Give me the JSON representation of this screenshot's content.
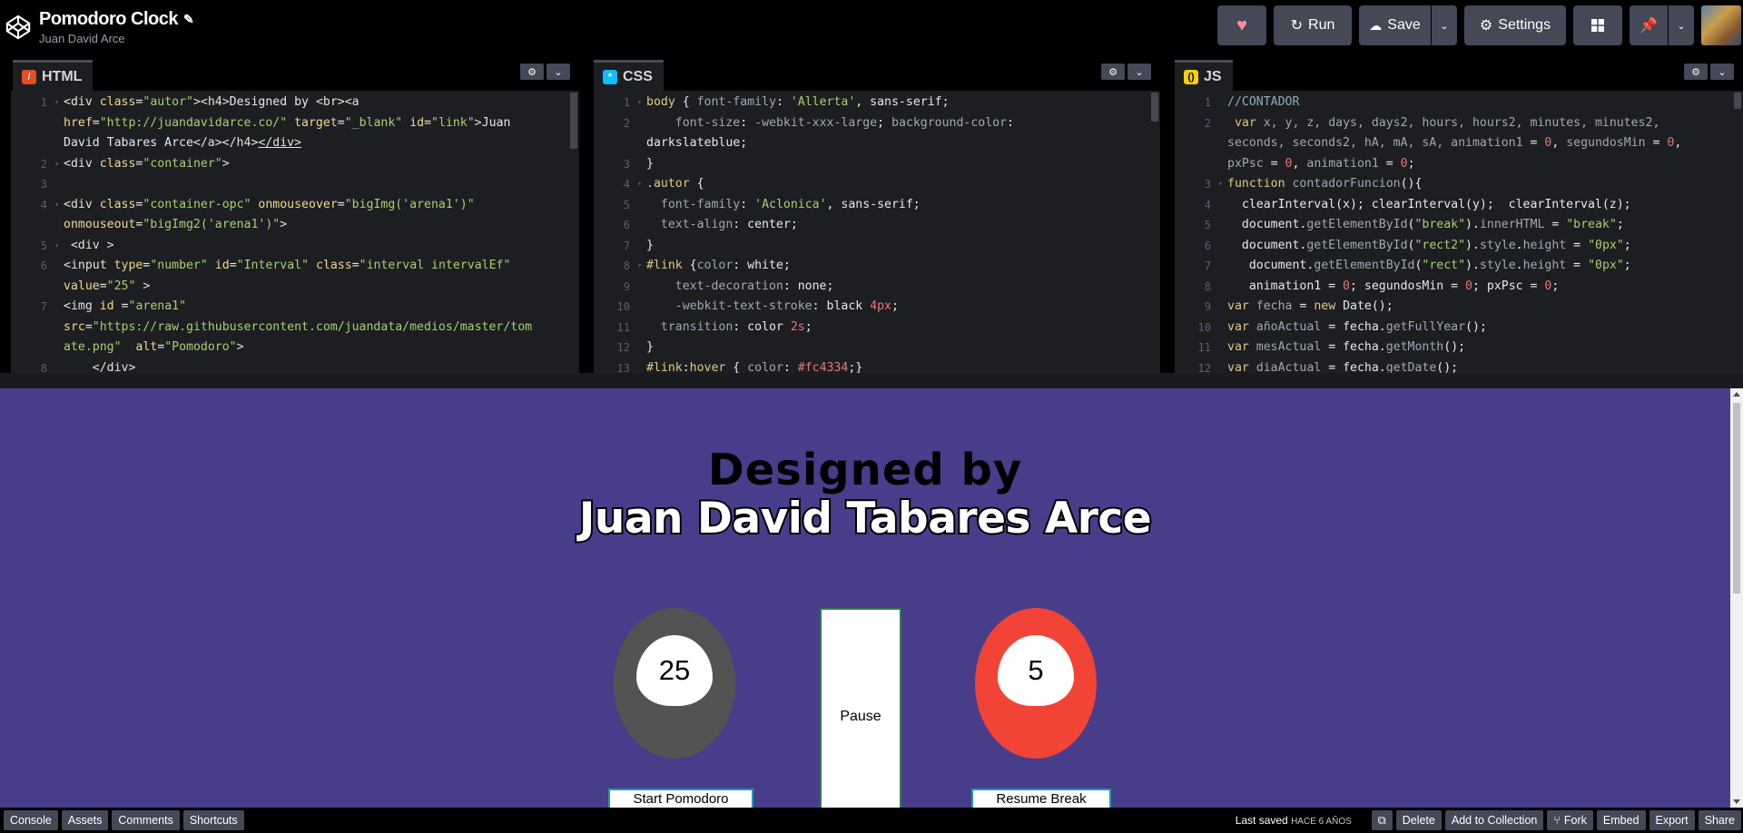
{
  "header": {
    "pen_title": "Pomodoro Clock",
    "author": "Juan David Arce",
    "buttons": {
      "run": "Run",
      "save": "Save",
      "settings": "Settings"
    }
  },
  "editors": {
    "html": {
      "label": "HTML",
      "icon_color": "#e44d26",
      "icon_glyph": "/"
    },
    "css": {
      "label": "CSS",
      "icon_color": "#0ebeff",
      "icon_glyph": "*"
    },
    "js": {
      "label": "JS",
      "icon_color": "#fcd000",
      "icon_glyph": "()"
    }
  },
  "preview": {
    "background": "#483d8b",
    "designed_by": "Designed by",
    "designer_name": "Juan David Tabares Arce",
    "pomodoro_value": "25",
    "break_value": "5",
    "pause_label": "Pause",
    "start_pomodoro_label": "Start Pomodoro",
    "resume_break_label": "Resume Break"
  },
  "footer": {
    "buttons": [
      "Console",
      "Assets",
      "Comments",
      "Shortcuts"
    ],
    "last_saved_label": "Last saved",
    "last_saved_value": "HACE 6 AÑOS",
    "right_buttons": [
      "Delete",
      "Add to Collection",
      "Fork",
      "Embed",
      "Export",
      "Share"
    ]
  },
  "colors": {
    "header_bg": "#000000",
    "button_bg": "#444857",
    "editor_bg": "#1d1e22",
    "heart": "#ff8f9a",
    "pomodoro_egg": "#535353",
    "break_egg": "#f24436"
  }
}
